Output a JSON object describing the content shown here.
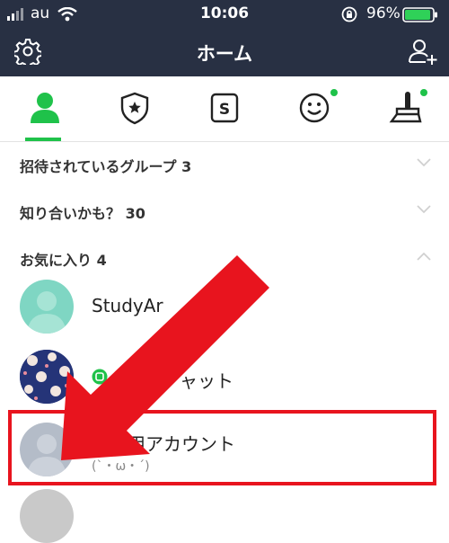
{
  "status_bar": {
    "carrier": "au",
    "time": "10:06",
    "battery": "96%",
    "icons": [
      "signal-icon",
      "wifi-icon",
      "rotation-lock-icon",
      "battery-icon"
    ]
  },
  "header": {
    "title": "ホーム",
    "left_icon": "settings-gear-icon",
    "right_icon": "add-friend-icon"
  },
  "tabs": [
    {
      "icon": "person-icon",
      "active": true,
      "badge": false
    },
    {
      "icon": "shield-star-icon",
      "active": false,
      "badge": false
    },
    {
      "icon": "sticker-s-icon",
      "active": false,
      "badge": false
    },
    {
      "icon": "smiley-icon",
      "active": false,
      "badge": true
    },
    {
      "icon": "theme-brush-icon",
      "active": false,
      "badge": true
    }
  ],
  "sections": {
    "invited_groups": "招待されているグループ 3",
    "maybe_know": "知り合いかも？ 30",
    "favorites": "お気に入り 4"
  },
  "friends": [
    {
      "name": "StudyAr",
      "status": ""
    },
    {
      "name": "ャット",
      "status": ""
    },
    {
      "name": "練習用アカウント",
      "status": "(ˋ・ω・ˊ)"
    }
  ],
  "colors": {
    "header_bg": "#283043",
    "accent_green": "#1fc24a",
    "highlight_red": "#e8141e",
    "avatar_teal": "#7fd6c3",
    "avatar_gray": "#b4bcc8",
    "pattern_navy": "#253478"
  }
}
